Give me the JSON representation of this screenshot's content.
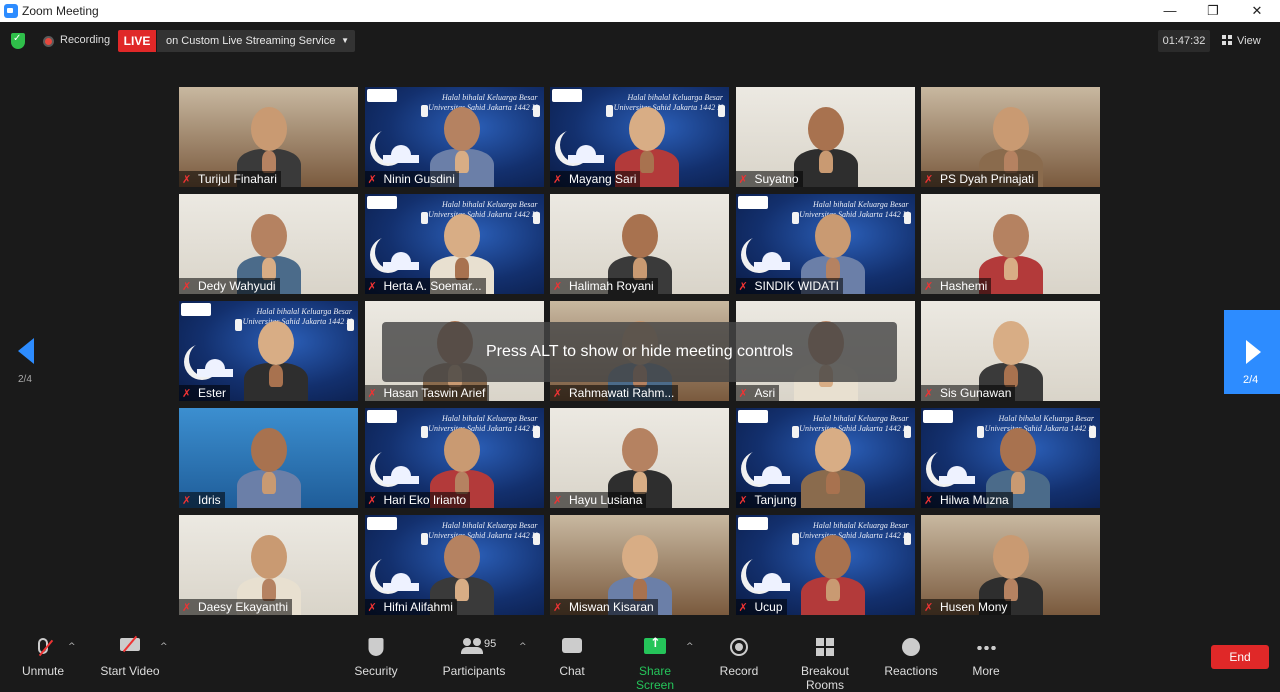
{
  "window": {
    "title": "Zoom Meeting",
    "minimize": "—",
    "restore": "❐",
    "close": "✕"
  },
  "topbar": {
    "recording_label": "Recording",
    "live_label": "LIVE",
    "live_destination": "on Custom Live Streaming Service",
    "elapsed_time": "01:47:32",
    "view_label": "View"
  },
  "pagination": {
    "left_page": "2/4",
    "right_page": "2/4"
  },
  "hint": "Press ALT to show or hide meeting controls",
  "participants": [
    {
      "name": "Turijul Finahari",
      "style": "room"
    },
    {
      "name": "Ninin Gusdini",
      "style": "banner"
    },
    {
      "name": "Mayang Sari",
      "style": "banner"
    },
    {
      "name": "Suyatno",
      "style": "wall"
    },
    {
      "name": "PS Dyah Prinajati",
      "style": "room"
    },
    {
      "name": "Dedy Wahyudi",
      "style": "wall"
    },
    {
      "name": "Herta A. Soemar...",
      "style": "banner"
    },
    {
      "name": "Halimah Royani",
      "style": "wall"
    },
    {
      "name": "SINDIK WIDATI",
      "style": "banner"
    },
    {
      "name": "Hashemi",
      "style": "wall"
    },
    {
      "name": "Ester",
      "style": "banner"
    },
    {
      "name": "Hasan Taswin Arief",
      "style": "wall"
    },
    {
      "name": "Rahmawati Rahm...",
      "style": "room"
    },
    {
      "name": "Asri",
      "style": "wall"
    },
    {
      "name": "Sis Gunawan",
      "style": "wall"
    },
    {
      "name": "Idris",
      "style": "blue"
    },
    {
      "name": "Hari Eko Irianto",
      "style": "banner"
    },
    {
      "name": "Hayu Lusiana",
      "style": "wall"
    },
    {
      "name": "Tanjung",
      "style": "banner"
    },
    {
      "name": "Hilwa Muzna",
      "style": "banner"
    },
    {
      "name": "Daesy Ekayanthi",
      "style": "wall"
    },
    {
      "name": "Hifni Alifahmi",
      "style": "banner"
    },
    {
      "name": "Miswan Kisaran",
      "style": "room"
    },
    {
      "name": "Ucup",
      "style": "banner"
    },
    {
      "name": "Husen Mony",
      "style": "room"
    }
  ],
  "banner_text": "Halal bihalal Keluarga Besar\nUniversitas Sahid Jakarta 1442 H",
  "toolbar": {
    "unmute": "Unmute",
    "start_video": "Start Video",
    "security": "Security",
    "participants": "Participants",
    "participants_count": "95",
    "chat": "Chat",
    "share_screen": "Share Screen",
    "record": "Record",
    "breakout_rooms": "Breakout Rooms",
    "reactions": "Reactions",
    "more": "More",
    "end": "End"
  },
  "colors": {
    "accent": "#2d8cff",
    "live": "#e02828",
    "share": "#25c45a",
    "muted": "#e33333"
  }
}
